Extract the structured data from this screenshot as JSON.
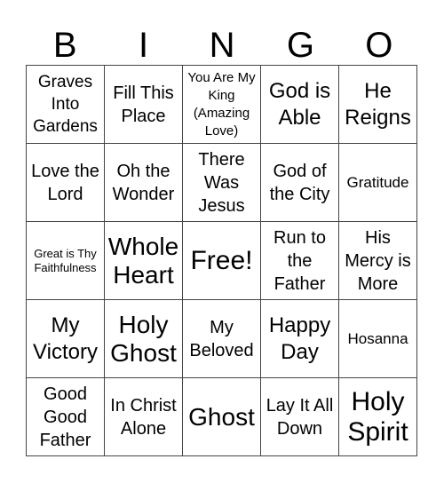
{
  "header": [
    "B",
    "I",
    "N",
    "G",
    "O"
  ],
  "cells": [
    "Graves Into Gardens",
    "Fill This Place",
    "You Are My King (Amazing Love)",
    "God is Able",
    "He Reigns",
    "Love the Lord",
    "Oh the Wonder",
    "There Was Jesus",
    "God of the City",
    "Gratitude",
    "Great is Thy Faithfulness",
    "Whole Heart",
    "Free!",
    "Run to the Father",
    "His Mercy is More",
    "My Victory",
    "Holy Ghost",
    "My Beloved",
    "Happy Day",
    "Hosanna",
    "Good Good Father",
    "In Christ Alone",
    "Ghost",
    "Lay It All Down",
    "Holy Spirit"
  ]
}
